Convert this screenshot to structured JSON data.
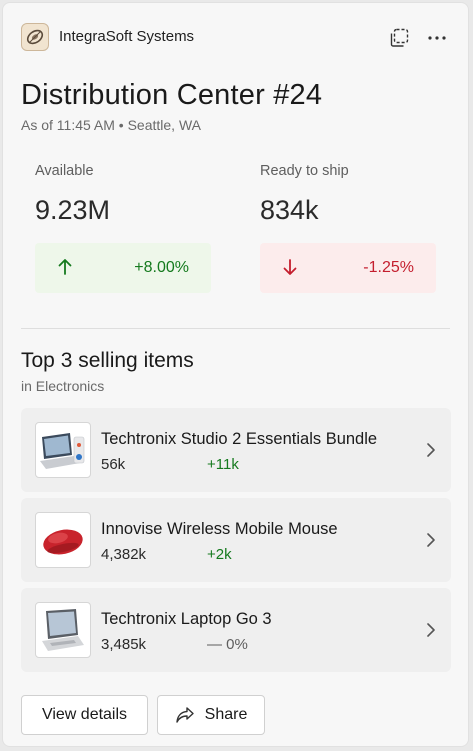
{
  "header": {
    "app_name": "IntegraSoft Systems",
    "logo_icon": "integrasoft-logo",
    "copy_icon": "copy-icon",
    "more_icon": "more-icon"
  },
  "title": "Distribution Center #24",
  "subtitle": "As of 11:45 AM • Seattle, WA",
  "metrics": [
    {
      "label": "Available",
      "value": "9.23M",
      "change": "+8.00%",
      "direction": "up"
    },
    {
      "label": "Ready to ship",
      "value": "834k",
      "change": "-1.25%",
      "direction": "down"
    }
  ],
  "top_items": {
    "title": "Top 3 selling items",
    "subtitle": "in Electronics",
    "items": [
      {
        "name": "Techtronix Studio 2 Essentials Bundle",
        "count": "56k",
        "change": "+11k",
        "trend": "positive",
        "image": "laptop-bundle-image"
      },
      {
        "name": "Innovise Wireless Mobile Mouse",
        "count": "4,382k",
        "change": "+2k",
        "trend": "positive",
        "image": "red-mouse-image"
      },
      {
        "name": "Techtronix Laptop Go 3",
        "count": "3,485k",
        "change": "— 0%",
        "trend": "neutral",
        "image": "laptop-image"
      }
    ]
  },
  "actions": {
    "view_details": "View details",
    "share": "Share"
  },
  "colors": {
    "positive": "#157a1e",
    "negative": "#c41e2e",
    "positive_bg": "#eef7ea",
    "negative_bg": "#fcecec"
  }
}
